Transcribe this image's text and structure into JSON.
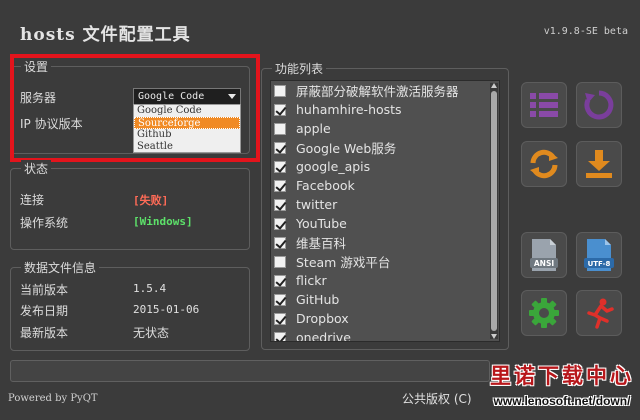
{
  "app": {
    "title": "hosts 文件配置工具",
    "version": "v1.9.8-SE beta"
  },
  "settings": {
    "group_title": "设置",
    "server_label": "服务器",
    "ip_label": "IP 协议版本",
    "server_selected": "Google Code",
    "server_options": [
      "Google Code",
      "Sourceforge",
      "Github",
      "Seattle"
    ],
    "highlighted_option": "Sourceforge"
  },
  "status": {
    "group_title": "状态",
    "connection_label": "连接",
    "connection_value": "[失败]",
    "os_label": "操作系统",
    "os_value": "[Windows]"
  },
  "datafile": {
    "group_title": "数据文件信息",
    "current_label": "当前版本",
    "current_value": "1.5.4",
    "release_label": "发布日期",
    "release_value": "2015-01-06",
    "latest_label": "最新版本",
    "latest_value": "无状态"
  },
  "functions": {
    "group_title": "功能列表",
    "items": [
      {
        "label": "屏蔽部分破解软件激活服务器",
        "checked": false
      },
      {
        "label": "huhamhire-hosts",
        "checked": true
      },
      {
        "label": "apple",
        "checked": false
      },
      {
        "label": "Google Web服务",
        "checked": true
      },
      {
        "label": "google_apis",
        "checked": true
      },
      {
        "label": "Facebook",
        "checked": true
      },
      {
        "label": "twitter",
        "checked": true
      },
      {
        "label": "YouTube",
        "checked": true
      },
      {
        "label": "维基百科",
        "checked": true
      },
      {
        "label": "Steam 游戏平台",
        "checked": false
      },
      {
        "label": "flickr",
        "checked": true
      },
      {
        "label": "GitHub",
        "checked": true
      },
      {
        "label": "Dropbox",
        "checked": true
      },
      {
        "label": "onedrive",
        "checked": true
      }
    ]
  },
  "toolbar": {
    "buttons": [
      {
        "name": "list-icon",
        "color": "#8a4aa8"
      },
      {
        "name": "refresh-icon",
        "color": "#7a3e9c"
      },
      {
        "name": "sync-icon",
        "color": "#e08a1e"
      },
      {
        "name": "download-icon",
        "color": "#e08a1e"
      },
      {
        "name": "ansi-file-icon",
        "text": "ANSI",
        "color": "#9aa3ad"
      },
      {
        "name": "utf8-file-icon",
        "text": "UTF-8",
        "color": "#4a8fcf"
      },
      {
        "name": "settings-icon",
        "color": "#3aa63a"
      },
      {
        "name": "exit-run-icon",
        "color": "#e0302a"
      }
    ]
  },
  "footer": {
    "powered": "Powered by PyQT",
    "copyright": "公共版权 (C)"
  },
  "watermark": {
    "cn": "里诺下载中心",
    "url": "www.lenosoft.net/down/"
  }
}
